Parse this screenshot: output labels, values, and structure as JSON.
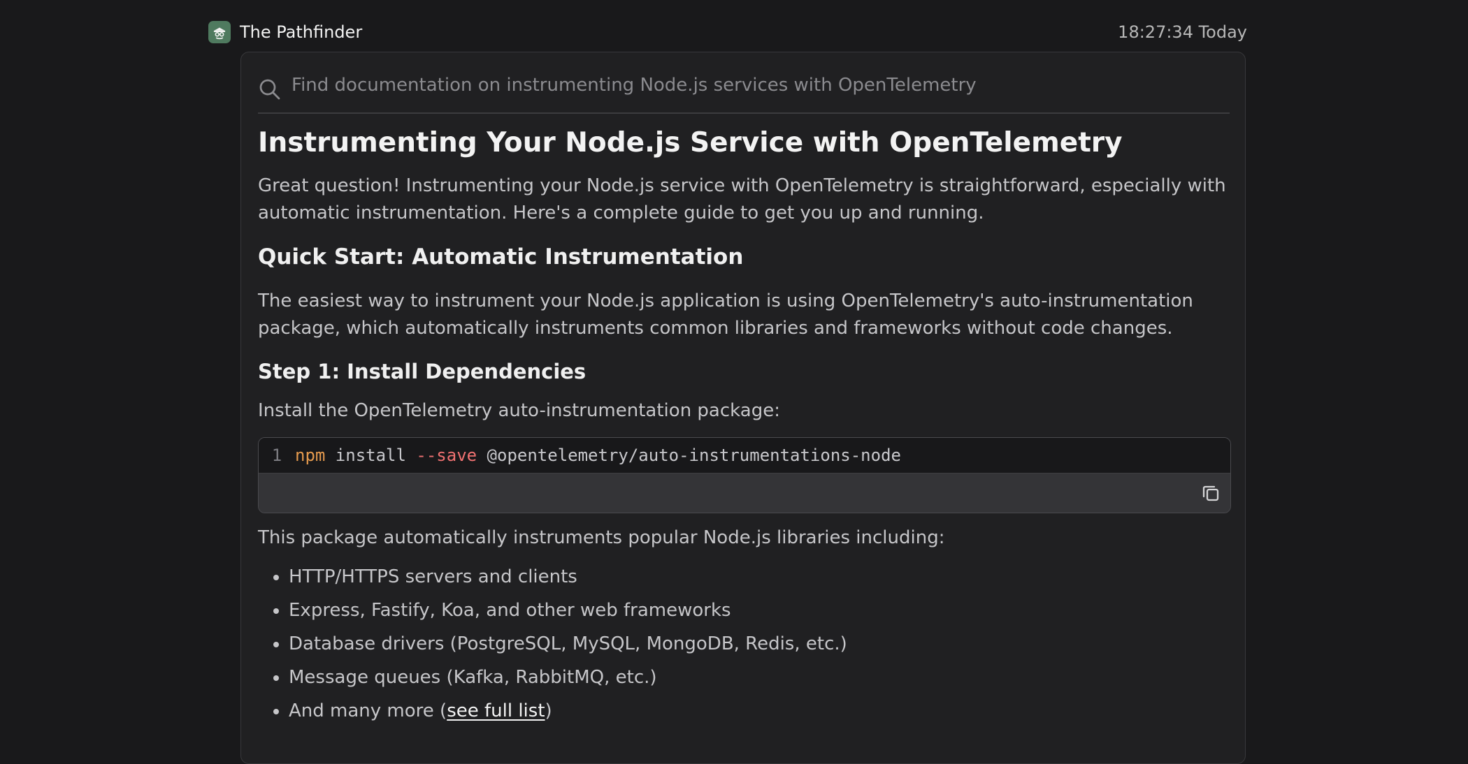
{
  "header": {
    "app_name": "The Pathfinder",
    "logo_icon": "pathfinder-logo-icon",
    "timestamp": "18:27:34 Today"
  },
  "search": {
    "icon": "search-icon",
    "query": "Find documentation on instrumenting Node.js services with OpenTelemetry"
  },
  "article": {
    "title": "Instrumenting Your Node.js Service with OpenTelemetry",
    "intro": "Great question! Instrumenting your Node.js service with OpenTelemetry is straightforward, especially with automatic instrumentation. Here's a complete guide to get you up and running.",
    "quick_start_heading": "Quick Start: Automatic Instrumentation",
    "quick_start_text": "The easiest way to instrument your Node.js application is using OpenTelemetry's auto-instrumentation package, which automatically instruments common libraries and frameworks without code changes.",
    "step1_heading": "Step 1: Install Dependencies",
    "step1_text": "Install the OpenTelemetry auto-instrumentation package:",
    "code": {
      "line_number": "1",
      "command": "npm",
      "subcommand": " install ",
      "flag": "--save",
      "package": " @opentelemetry/auto-instrumentations-node",
      "copy_icon": "copy-icon"
    },
    "list_intro": "This package automatically instruments popular Node.js libraries including:",
    "libraries": [
      "HTTP/HTTPS servers and clients",
      "Express, Fastify, Koa, and other web frameworks",
      "Database drivers (PostgreSQL, MySQL, MongoDB, Redis, etc.)",
      "Message queues (Kafka, RabbitMQ, etc.)"
    ],
    "more_prefix": "And many more (",
    "more_link": "see full list",
    "more_suffix": ")"
  },
  "colors": {
    "background": "#19191b",
    "panel": "#202022",
    "logo": "#4f7a5f",
    "code_command": "#e59a4e",
    "code_flag": "#f07171"
  }
}
